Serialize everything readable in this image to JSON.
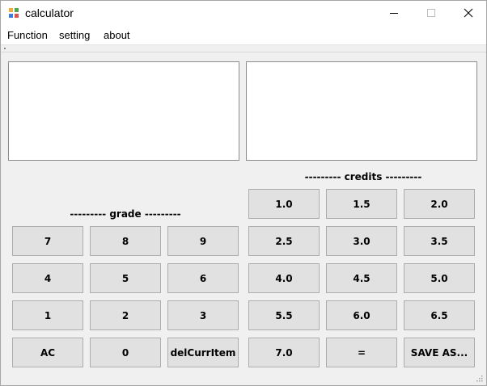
{
  "window": {
    "title": "calculator",
    "icon": "app-grid-icon",
    "controls": [
      "minimize-icon",
      "maximize-icon",
      "close-icon"
    ]
  },
  "menu": {
    "function": "Function",
    "setting": "setting",
    "about": "about"
  },
  "grade": {
    "label": "--------- grade ---------",
    "buttons": {
      "seven": "7",
      "eight": "8",
      "nine": "9",
      "four": "4",
      "five": "5",
      "six": "6",
      "one": "1",
      "two": "2",
      "three": "3",
      "ac": "AC",
      "zero": "0",
      "del": "delCurrItem"
    }
  },
  "credits": {
    "label": "--------- credits ---------",
    "buttons": {
      "c1_0": "1.0",
      "c1_5": "1.5",
      "c2_0": "2.0",
      "c2_5": "2.5",
      "c3_0": "3.0",
      "c3_5": "3.5",
      "c4_0": "4.0",
      "c4_5": "4.5",
      "c5_0": "5.0",
      "c5_5": "5.5",
      "c6_0": "6.0",
      "c6_5": "6.5",
      "c7_0": "7.0",
      "equals": "=",
      "save_as": "SAVE AS..."
    }
  },
  "colors": {
    "button_bg": "#e1e1e1",
    "button_border": "#adadad",
    "window_bg": "#f0f0f0",
    "icon_colors": [
      "#f2a93b",
      "#4ea64e",
      "#3b7ddd",
      "#d9534f"
    ]
  }
}
